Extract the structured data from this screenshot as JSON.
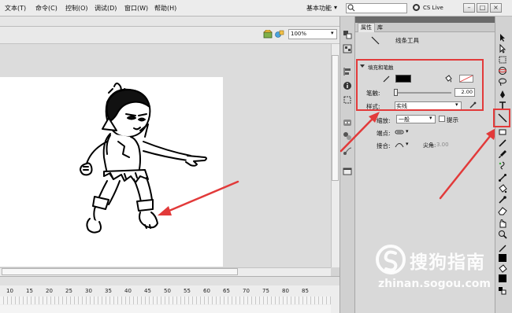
{
  "menu": {
    "items": [
      "文本(T)",
      "命令(C)",
      "控制(O)",
      "调试(D)",
      "窗口(W)",
      "帮助(H)"
    ]
  },
  "workspace": {
    "label": "基本功能"
  },
  "search": {
    "placeholder": ""
  },
  "cslive": {
    "label": "CS Live"
  },
  "window_controls": {
    "minimize": "–",
    "restore": "□",
    "close": "×"
  },
  "edit_bar": {
    "zoom": "100%"
  },
  "timeline": {
    "ticks": [
      "10",
      "15",
      "20",
      "25",
      "30",
      "35",
      "40",
      "45",
      "50",
      "55",
      "60",
      "65",
      "70",
      "75",
      "80",
      "85"
    ]
  },
  "panel": {
    "tabs": [
      "属性",
      "库"
    ],
    "tool_name": "线条工具",
    "section_title": "填充和笔触",
    "stroke_label": "笔触:",
    "stroke_value": "2.00",
    "style_label": "样式:",
    "style_value": "实线",
    "scale_label": "缩放:",
    "scale_value": "一般",
    "hint_label": "提示",
    "cap_label": "端点:",
    "join_label": "接合:",
    "miter_label": "尖角:",
    "miter_value": "3.00"
  },
  "colors": {
    "stroke": "#000000",
    "highlight": "#e23a3a",
    "accent": "#1a6fd6"
  },
  "icons": {
    "tools": [
      "selection-icon",
      "subselection-icon",
      "free-transform-icon",
      "3d-rotation-icon",
      "lasso-icon",
      "pen-icon",
      "text-icon",
      "line-icon",
      "rectangle-icon",
      "pencil-icon",
      "brush-icon",
      "deco-icon",
      "bone-icon",
      "paint-bucket-icon",
      "eyedropper-icon",
      "eraser-icon",
      "hand-icon",
      "zoom-icon",
      "stroke-color-icon",
      "fill-color-icon"
    ]
  },
  "watermark": {
    "text": "搜狗指南",
    "url": "zhinan.sogou.com"
  }
}
